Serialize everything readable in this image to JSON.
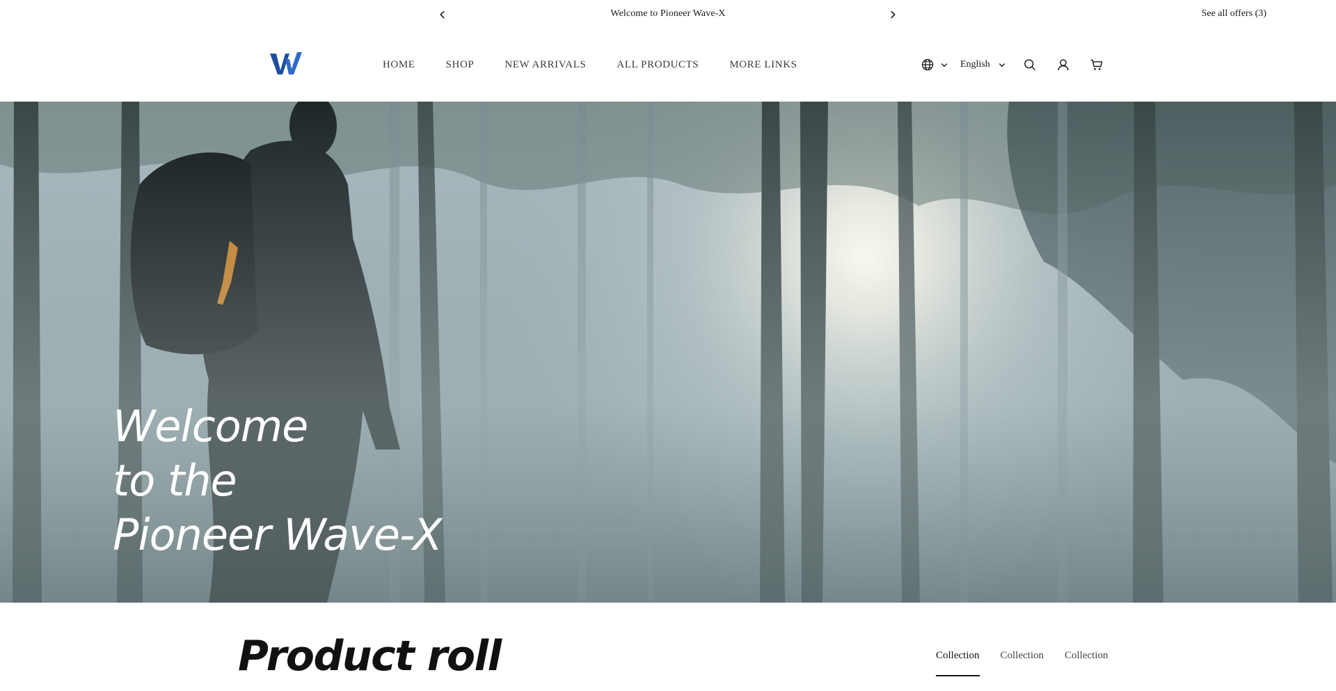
{
  "announcement": {
    "message": "Welcome to  Pioneer Wave-X",
    "offers_link": "See all offers (3)",
    "prev_icon": "chevron-left-icon",
    "next_icon": "chevron-right-icon"
  },
  "header": {
    "logo": "W",
    "nav": [
      {
        "label": "HOME"
      },
      {
        "label": "SHOP"
      },
      {
        "label": "NEW ARRIVALS"
      },
      {
        "label": "ALL PRODUCTS"
      },
      {
        "label": "MORE LINKS"
      }
    ],
    "language": "English",
    "icons": [
      "globe-icon",
      "chevron-down-icon",
      "search-icon",
      "account-icon",
      "cart-icon"
    ]
  },
  "hero": {
    "title_lines": [
      "Welcome",
      "to  the",
      "Pioneer Wave-X"
    ]
  },
  "product_roll": {
    "title": "Product roll",
    "tabs": [
      {
        "label": "Collection",
        "active": true
      },
      {
        "label": "Collection",
        "active": false
      },
      {
        "label": "Collection",
        "active": false
      }
    ]
  },
  "colors": {
    "logo_blue": "#1f4e9c",
    "text": "#1a1a1a",
    "hero_text": "#ffffff"
  }
}
